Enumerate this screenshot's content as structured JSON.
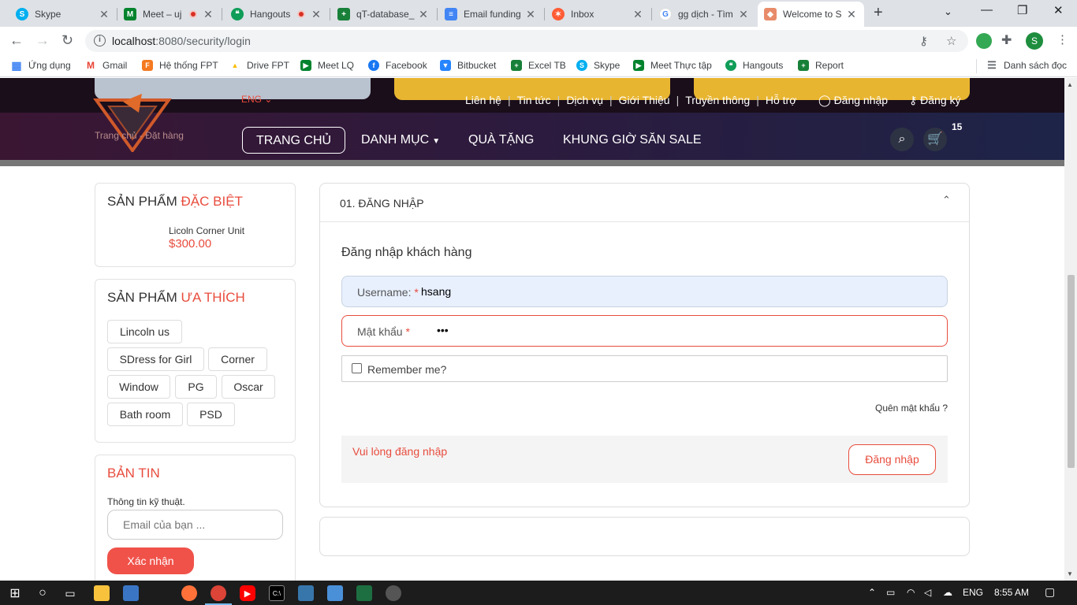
{
  "browser": {
    "tabs": [
      {
        "title": "Skype",
        "favicon_color": "#00aff0",
        "favicon_glyph": "S"
      },
      {
        "title": "Meet – uj",
        "favicon_color": "#00832d",
        "favicon_glyph": "M",
        "recording": true
      },
      {
        "title": "Hangouts",
        "favicon_color": "#0f9d58",
        "favicon_glyph": "❝",
        "recording": true
      },
      {
        "title": "qT-database_",
        "favicon_color": "#188038",
        "favicon_glyph": "+"
      },
      {
        "title": "Email funding",
        "favicon_color": "#4285f4",
        "favicon_glyph": "≡"
      },
      {
        "title": "Inbox",
        "favicon_color": "#ff5c35",
        "favicon_glyph": "✶"
      },
      {
        "title": "gg dịch - Tìm",
        "favicon_color": "#4285f4",
        "favicon_glyph": "G"
      },
      {
        "title": "Welcome to S",
        "favicon_color": "#e88b6a",
        "favicon_glyph": "◆",
        "active": true
      }
    ],
    "url_host": "localhost",
    "url_path": ":8080/security/login",
    "bookmarks": [
      {
        "label": "Ứng dụng",
        "color": "#4285f4",
        "glyph": "▦"
      },
      {
        "label": "Gmail",
        "color": "#ea4335",
        "glyph": "M"
      },
      {
        "label": "Hệ thống FPT",
        "color": "#f47920",
        "glyph": "F"
      },
      {
        "label": "Drive FPT",
        "color": "#fbbc04",
        "glyph": "▲"
      },
      {
        "label": "Meet LQ",
        "color": "#00832d",
        "glyph": "▶"
      },
      {
        "label": "Facebook",
        "color": "#1877f2",
        "glyph": "f"
      },
      {
        "label": "Bitbucket",
        "color": "#2684ff",
        "glyph": "▼"
      },
      {
        "label": "Excel TB",
        "color": "#188038",
        "glyph": "+"
      },
      {
        "label": "Skype",
        "color": "#00aff0",
        "glyph": "S"
      },
      {
        "label": "Meet Thực tập",
        "color": "#00832d",
        "glyph": "▶"
      },
      {
        "label": "Hangouts",
        "color": "#0f9d58",
        "glyph": "❝"
      },
      {
        "label": "Report",
        "color": "#188038",
        "glyph": "+"
      }
    ],
    "reading_list": "Danh sách đọc",
    "profile_initial": "S"
  },
  "site": {
    "lang": "ENG",
    "top_links": [
      "Liên hệ",
      "Tin tức",
      "Dịch vụ",
      "Giới Thiệu",
      "Truyền thông",
      "Hỗ trợ"
    ],
    "login_link": "Đăng nhập",
    "register_link": "Đăng ký",
    "breadcrumb": "Trang chủ - Đặt hàng",
    "menu": {
      "home": "TRANG CHỦ",
      "categories": "DANH MỤC",
      "gifts": "QUÀ TẶNG",
      "flash_sale": "KHUNG GIỜ SĂN SALE"
    },
    "cart_count": "15"
  },
  "sidebar": {
    "special": {
      "title_a": "SẢN PHẨM",
      "title_b": "ĐẶC BIỆT",
      "product_name": "Licoln Corner Unit",
      "product_price": "$300.00"
    },
    "favorites": {
      "title_a": "SẢN PHẨM",
      "title_b": "ƯA THÍCH",
      "tags": [
        "Lincoln us",
        "SDress for Girl",
        "Corner",
        "Window",
        "PG",
        "Oscar",
        "Bath room",
        "PSD"
      ]
    },
    "newsletter": {
      "title": "BẢN TIN",
      "subtitle": "Thông tin kỹ thuật.",
      "email_placeholder": "Email của bạn ...",
      "submit": "Xác nhận"
    }
  },
  "login": {
    "section_title": "01. ĐĂNG NHẬP",
    "heading": "Đăng nhập khách hàng",
    "username_label": "Username:",
    "username_value": "hsang",
    "password_label": "Mật khẩu",
    "password_value": "•••",
    "remember_label": "Remember me?",
    "forgot": "Quên mật khẩu ?",
    "message": "Vui lòng đăng nhập",
    "submit": "Đăng nhập"
  },
  "taskbar": {
    "lang": "ENG",
    "time": "8:55 AM"
  }
}
